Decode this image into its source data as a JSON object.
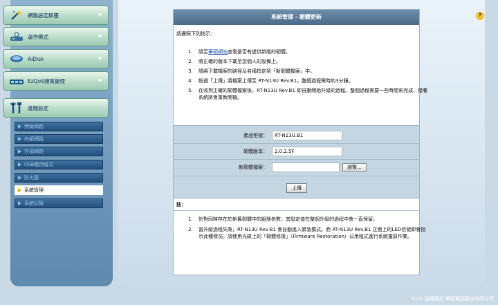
{
  "sidebar": {
    "menu": [
      {
        "label": "網路設定精靈"
      },
      {
        "label": "運作模式"
      },
      {
        "label": "AiDisk"
      },
      {
        "label": "EzQoS頻寬管理"
      },
      {
        "label": "進階設定"
      }
    ],
    "submenu": [
      {
        "label": "無線網路",
        "active": false
      },
      {
        "label": "內部網路",
        "active": false
      },
      {
        "label": "外部網路",
        "active": false
      },
      {
        "label": "USB應用程式",
        "active": false
      },
      {
        "label": "防火牆",
        "active": false
      },
      {
        "label": "系統管理",
        "active": true
      },
      {
        "label": "系統記錄",
        "active": false
      }
    ]
  },
  "panel": {
    "title": "系統管理 - 韌體更新",
    "intro": "請遵照下列指示：",
    "steps": [
      {
        "before": "請至",
        "link": "華碩網站",
        "after": "查看是否有提供新版的韌體。"
      },
      {
        "before": "將正確的版本下載至您個人的設備上。",
        "link": "",
        "after": ""
      },
      {
        "before": "請將下載檔案的路徑及名稱指定到「新韌體檔案」中。",
        "link": "",
        "after": ""
      },
      {
        "before": "點選「上傳」將檔案上傳至 RT-N13U Rev.B1。整個過程需時約3分鐘。",
        "link": "",
        "after": ""
      },
      {
        "before": "在收到正確的韌體檔案後，RT-N13U Rev.B1 即自動開始升級的過程。整個過程需要一些時間來完成，接著系統將會重新開機。",
        "link": "",
        "after": ""
      }
    ],
    "form": {
      "product_label": "產品型號：",
      "product_value": "RT-N13U.B1",
      "firmware_label": "韌體版本：",
      "firmware_value": "2.0.2.5F",
      "newfile_label": "新韌體檔案：",
      "browse_label": "瀏覽...",
      "upload_label": "上傳"
    },
    "note_title": "註：",
    "notes": [
      "針對同時存在於新舊韌體中的組態參數，其設定值在整個升級的過程中會一直保留。",
      "當升級過程失敗，RT-N13U Rev.B1 會自動進入緊急模式。而 RT-N13U Rev.B1 正面上的LED信號即會指示此種情況。請使用光碟上的「韌體修復」（Firmware Restoration）公用程式進行系統還原作業。"
    ]
  },
  "help_icon": "?",
  "footer": "2011 版權屬於 華碩電腦股份有限公司"
}
